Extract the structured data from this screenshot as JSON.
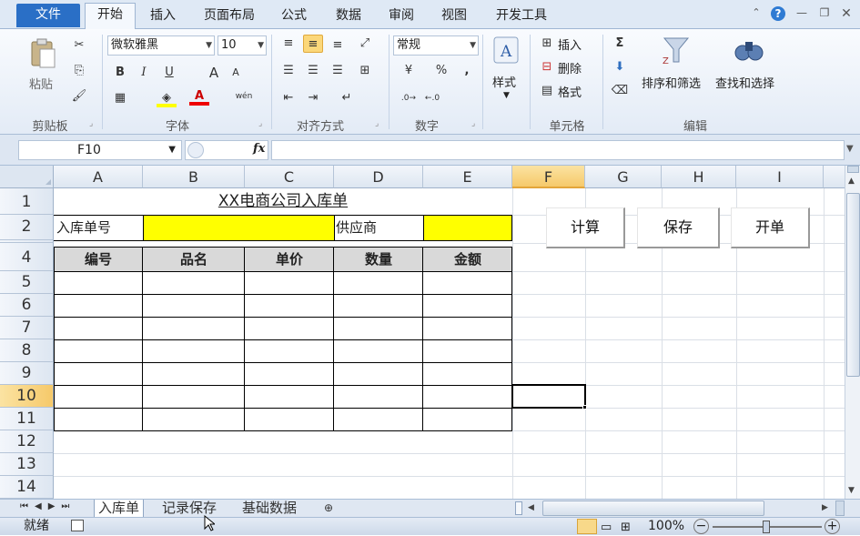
{
  "ribbon_tabs": [
    "文件",
    "开始",
    "插入",
    "页面布局",
    "公式",
    "数据",
    "审阅",
    "视图",
    "开发工具"
  ],
  "clipboard": {
    "paste": "粘贴",
    "label": "剪贴板"
  },
  "font": {
    "family": "微软雅黑",
    "size": "10",
    "bold": "B",
    "italic": "I",
    "underline": "U",
    "grow": "A",
    "shrink": "A",
    "label": "字体",
    "phonetic": "wén"
  },
  "alignment": {
    "label": "对齐方式"
  },
  "number": {
    "format": "常规",
    "percent": "%",
    "comma": ",",
    "label": "数字",
    "currency": "¥"
  },
  "styles": {
    "label": "样式"
  },
  "cells": {
    "insert": "插入",
    "delete": "删除",
    "format": "格式",
    "label": "单元格"
  },
  "editing": {
    "sum": "Σ",
    "sort_filter": "排序和筛选",
    "find_select": "查找和选择",
    "label": "编辑"
  },
  "formula_bar": {
    "name_box": "F10",
    "fx": "fx",
    "value": ""
  },
  "columns": [
    "A",
    "B",
    "C",
    "D",
    "E",
    "F",
    "G",
    "H",
    "I"
  ],
  "selected_column": "F",
  "rows": [
    "1",
    "2",
    "4",
    "5",
    "6",
    "7",
    "8",
    "9",
    "10",
    "11",
    "12",
    "13",
    "14"
  ],
  "selected_row": "10",
  "sheet": {
    "title": "XX电商公司入库单",
    "receipt_no_label": "入库单号",
    "supplier_label": "供应商",
    "headers": [
      "编号",
      "品名",
      "单价",
      "数量",
      "金额"
    ]
  },
  "macro_buttons": [
    "计算",
    "保存",
    "开单"
  ],
  "sheet_tabs": [
    "入库单",
    "记录保存",
    "基础数据"
  ],
  "active_sheet": "入库单",
  "status": {
    "ready": "就绪",
    "zoom": "100%"
  },
  "colors": {
    "yellow": "#ffff00",
    "selection": "#f6c96a",
    "file_tab": "#2a6fc6"
  }
}
